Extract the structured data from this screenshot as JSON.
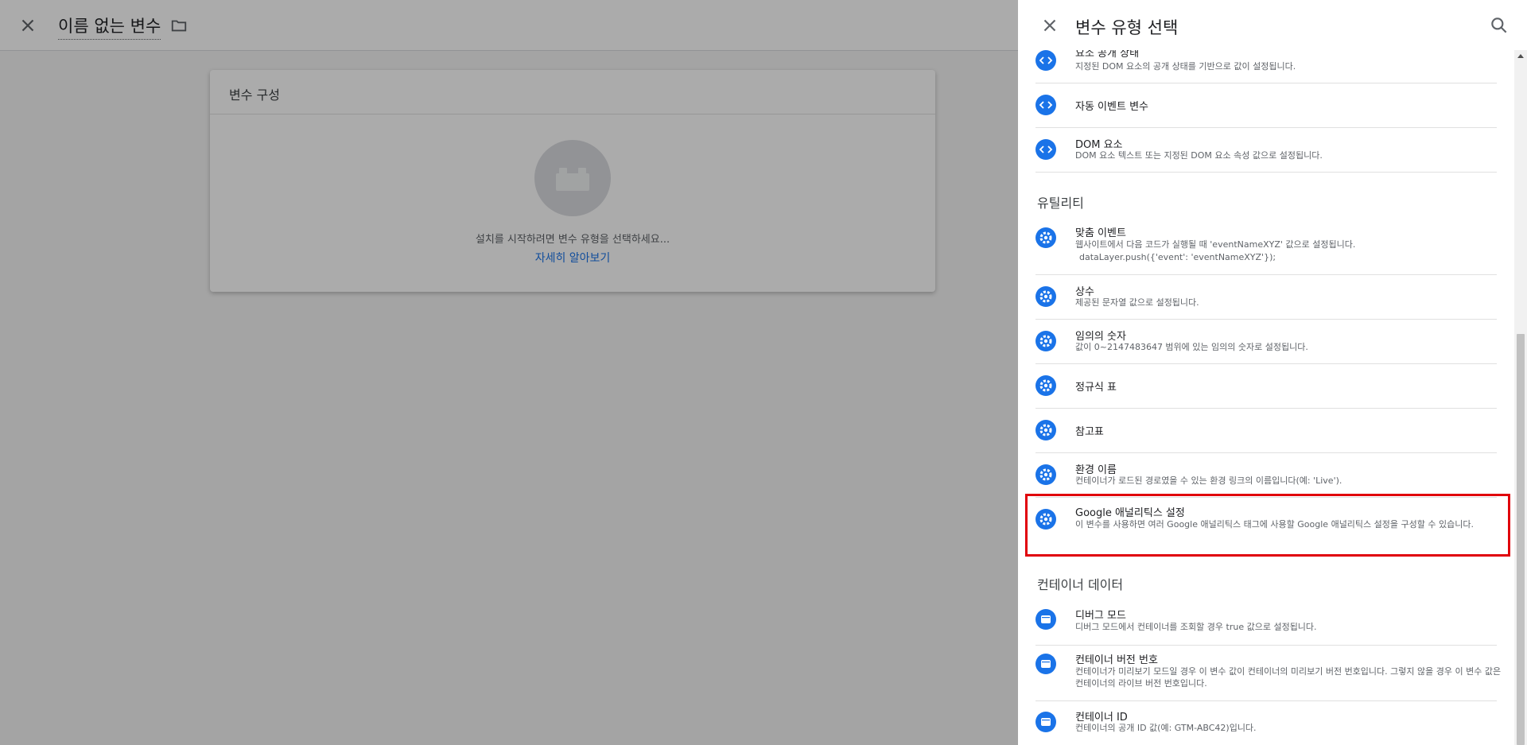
{
  "editor": {
    "title": "이름 없는 변수",
    "card_title": "변수 구성",
    "hint": "설치를 시작하려면 변수 유형을 선택하세요...",
    "learn_more": "자세히 알아보기"
  },
  "panel": {
    "title": "변수 유형 선택",
    "top_partial": {
      "name": "요소 공개 상태",
      "desc": "지정된 DOM 요소의 공개 상태를 기반으로 값이 설정됩니다."
    },
    "page_vars": [
      {
        "name": "자동 이벤트 변수",
        "desc": ""
      },
      {
        "name": "DOM 요소",
        "desc": "DOM 요소 텍스트 또는 지정된 DOM 요소 속성 값으로 설정됩니다."
      }
    ],
    "utilities_heading": "유틸리티",
    "utilities": [
      {
        "name": "맞춤 이벤트",
        "desc": "웹사이트에서 다음 코드가 실행될 때 'eventNameXYZ' 값으로 설정됩니다.",
        "desc2": "dataLayer.push({'event': 'eventNameXYZ'});"
      },
      {
        "name": "상수",
        "desc": "제공된 문자열 값으로 설정됩니다."
      },
      {
        "name": "임의의 숫자",
        "desc": "값이 0~2147483647 범위에 있는 임의의 숫자로 설정됩니다."
      },
      {
        "name": "정규식 표",
        "desc": ""
      },
      {
        "name": "참고표",
        "desc": ""
      },
      {
        "name": "환경 이름",
        "desc": "컨테이너가 로드된 경로였을 수 있는 환경 링크의 이름입니다(예: 'Live')."
      },
      {
        "name": "Google 애널리틱스 설정",
        "desc": "이 변수를 사용하면 여러 Google 애널리틱스 태그에 사용할 Google 애널리틱스 설정을 구성할 수 있습니다."
      }
    ],
    "container_heading": "컨테이너 데이터",
    "container": [
      {
        "name": "디버그 모드",
        "desc": "디버그 모드에서 컨테이너를 조회할 경우 true 값으로 설정됩니다."
      },
      {
        "name": "컨테이너 버전 번호",
        "desc": "컨테이너가 미리보기 모드일 경우 이 변수 값이 컨테이너의 미리보기 버전 번호입니다. 그렇지 않을 경우 이 변수 값은 컨테이너의 라이브 버전 번호입니다."
      },
      {
        "name": "컨테이너 ID",
        "desc": "컨테이너의 공개 ID 값(예: GTM-ABC42)입니다."
      }
    ]
  },
  "colors": {
    "accent": "#1a73e8",
    "highlight": "#e0000b"
  }
}
